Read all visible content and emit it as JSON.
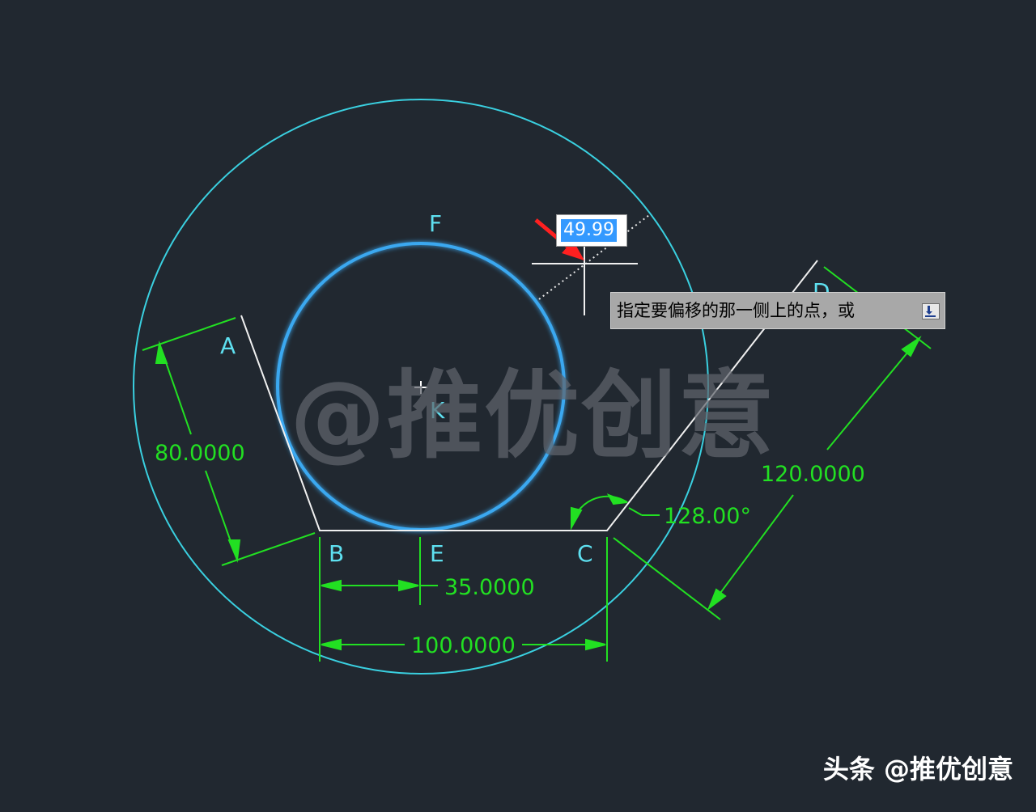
{
  "colors": {
    "background": "#212830",
    "outer_circle": "#3ad0e0",
    "inner_circle": "#3aa8f0",
    "polyline": "#f0f0f0",
    "dimension": "#22e022",
    "point_label": "#5ee0f0",
    "arrow": "#ff2020"
  },
  "points": {
    "A": "A",
    "B": "B",
    "C": "C",
    "D": "D",
    "E": "E",
    "F": "F",
    "K": "K"
  },
  "dimensions": {
    "ab": "80.0000",
    "be": "35.0000",
    "bc": "100.0000",
    "cd": "120.0000",
    "angle_c": "128.00°"
  },
  "offset_input": {
    "value": "49.99"
  },
  "tooltip": {
    "prompt": "指定要偏移的那一侧上的点，或",
    "dropdown_icon": "dropdown-arrow-icon"
  },
  "watermark": "@推优创意",
  "credit": "头条 @推优创意"
}
